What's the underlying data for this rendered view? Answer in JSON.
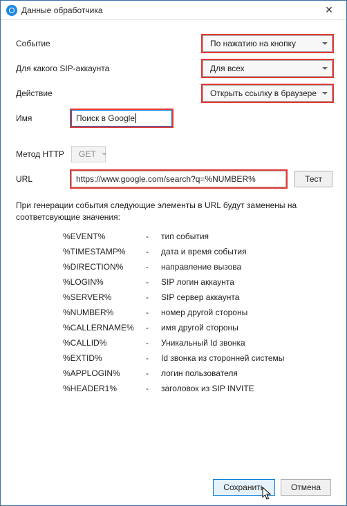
{
  "window": {
    "title": "Данные обработчика"
  },
  "fields": {
    "event_label": "Событие",
    "event_value": "По нажатию на кнопку",
    "sip_label": "Для какого SIP-аккаунта",
    "sip_value": "Для всех",
    "action_label": "Действие",
    "action_value": "Открыть ссылку в браузере",
    "name_label": "Имя",
    "name_value": "Поиск в Google",
    "method_label": "Метод HTTP",
    "method_value": "GET",
    "url_label": "URL",
    "url_value": "https://www.google.com/search?q=%NUMBER%",
    "test_btn": "Тест"
  },
  "info": "При генерации события следующие элементы в URL будут заменены на соответсвующие значения:",
  "macros": [
    {
      "token": "%EVENT%",
      "dash": "-",
      "desc": "тип события"
    },
    {
      "token": "%TIMESTAMP%",
      "dash": "-",
      "desc": "дата и время события"
    },
    {
      "token": "%DIRECTION%",
      "dash": "-",
      "desc": "направление вызова"
    },
    {
      "token": "%LOGIN%",
      "dash": "-",
      "desc": "SIP логин аккаунта"
    },
    {
      "token": "%SERVER%",
      "dash": "-",
      "desc": "SIP сервер аккаунта"
    },
    {
      "token": "%NUMBER%",
      "dash": "-",
      "desc": "номер другой стороны"
    },
    {
      "token": "%CALLERNAME%",
      "dash": "-",
      "desc": "имя другой стороны"
    },
    {
      "token": "%CALLID%",
      "dash": "-",
      "desc": "Уникальный Id звонка"
    },
    {
      "token": "%EXTID%",
      "dash": "-",
      "desc": "Id звонка из сторонней системы"
    },
    {
      "token": "%APPLOGIN%",
      "dash": "-",
      "desc": "логин пользователя"
    },
    {
      "token": "%HEADER1%",
      "dash": "-",
      "desc": "заголовок из SIP INVITE"
    }
  ],
  "buttons": {
    "save": "Сохранить",
    "cancel": "Отмена"
  }
}
